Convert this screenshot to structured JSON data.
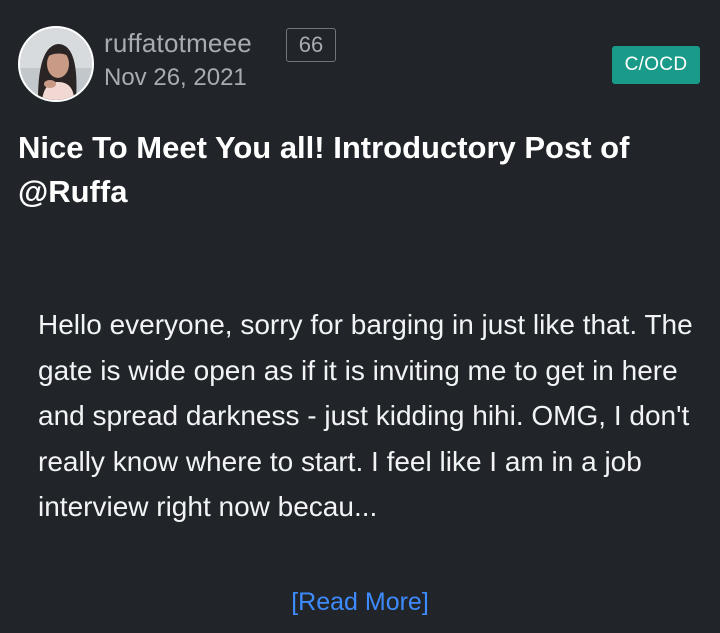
{
  "post": {
    "author": {
      "username": "ruffatotmeee",
      "reputation": "66",
      "avatar_icon": "avatar-photo-icon"
    },
    "date": "Nov 26, 2021",
    "community_tag": "C/OCD",
    "title": "Nice To Meet You all! Introductory Post of @Ruffa",
    "excerpt": "Hello everyone, sorry for barging in just like that. The gate is wide open as if it is inviting me to get in here and spread darkness - just kidding hihi. OMG, I don't really know where to start. I feel like I am in a job interview right now becau...",
    "read_more_label": "[Read More]"
  },
  "colors": {
    "background": "#212529",
    "tag_background": "#1a9b8a",
    "link": "#3d8bfd",
    "muted_text": "#a6acb2",
    "title_text": "#ffffff"
  }
}
